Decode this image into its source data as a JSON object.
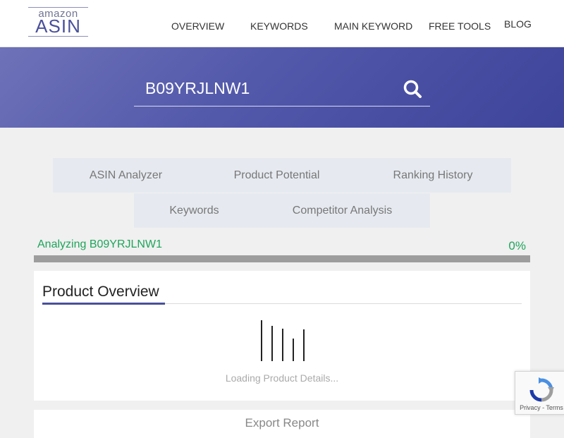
{
  "header": {
    "logo_top": "amazon",
    "logo_main": "ASIN",
    "nav": [
      "OVERVIEW",
      "KEYWORDS",
      "MAIN KEYWORD",
      "FREE TOOLS",
      "BLOG"
    ]
  },
  "search": {
    "value": "B09YRJLNW1",
    "icon": "search-icon"
  },
  "tabs": [
    "ASIN Analyzer",
    "Product Potential",
    "Ranking History",
    "Keywords",
    "Competitor Analysis"
  ],
  "progress": {
    "label": "Analyzing B09YRJLNW1",
    "percent_text": "0%",
    "value": 0
  },
  "product_overview": {
    "title": "Product Overview",
    "loading_text": "Loading Product Details..."
  },
  "export": {
    "label": "Export Report"
  },
  "recaptcha": {
    "privacy": "Privacy",
    "separator": " - ",
    "terms": "Terms"
  },
  "colors": {
    "accent": "#4a509a",
    "progress_green": "#1ea55b",
    "hero_start": "#6e72b8",
    "hero_end": "#3d449a"
  }
}
